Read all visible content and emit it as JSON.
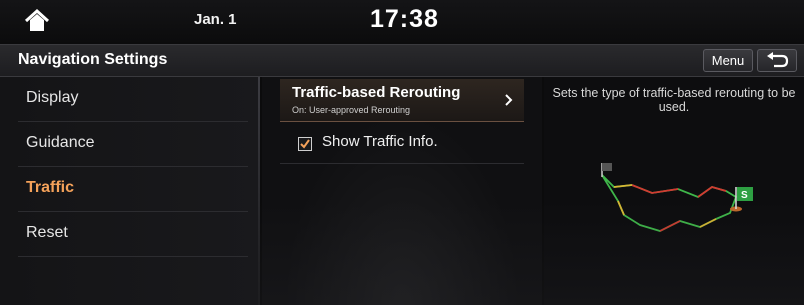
{
  "status_bar": {
    "date": "Jan. 1",
    "time": "17:38"
  },
  "title_bar": {
    "title": "Navigation Settings",
    "menu_label": "Menu"
  },
  "left_menu": {
    "items": [
      {
        "label": "Display",
        "active": false
      },
      {
        "label": "Guidance",
        "active": false
      },
      {
        "label": "Traffic",
        "active": true
      },
      {
        "label": "Reset",
        "active": false
      }
    ]
  },
  "settings": {
    "rerouting": {
      "title": "Traffic-based Rerouting",
      "subtitle": "On: User-approved Rerouting"
    },
    "show_traffic": {
      "label": "Show Traffic Info.",
      "checked": true
    }
  },
  "info_panel": {
    "description": "Sets the type of traffic-based rerouting to be used."
  },
  "colors": {
    "accent": "#f5a25a",
    "route_green": "#3fb64a",
    "route_red": "#d23a32",
    "route_yellow": "#d8b634",
    "flag_green": "#2ea043"
  },
  "icons": {
    "home": "home-icon",
    "back": "back-arrow-icon",
    "chevron": "chevron-right-icon",
    "check": "checkmark-icon"
  }
}
